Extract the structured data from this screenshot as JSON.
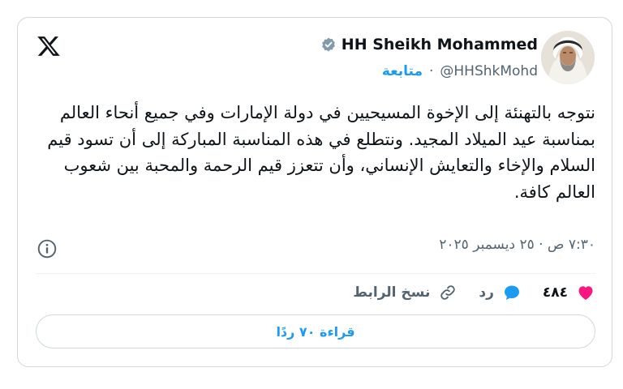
{
  "author": {
    "display_name": "HH Sheikh Mohammed",
    "handle": "@HHShkMohd",
    "separator": "·",
    "follow_label": "متابعة",
    "verified_color": "#829aab"
  },
  "tweet": {
    "text": "نتوجه بالتهنئة إلى الإخوة المسيحيين في دولة الإمارات وفي جميع أنحاء العالم بمناسبة عيد الميلاد المجيد. ونتطلع في هذه المناسبة المباركة إلى أن تسود قيم السلام والإخاء والتعايش الإنساني، وأن تتعزز قيم الرحمة والمحبة بين شعوب العالم كافة.",
    "timestamp": "٧:٣٠ ص · ٢٥ ديسمبر ٢٠٢٥"
  },
  "actions": {
    "like_count": "٤٨٤",
    "reply_label": "رد",
    "copy_link_label": "نسخ الرابط"
  },
  "read_replies_label": "قراءة ٧٠ ردًا",
  "colors": {
    "accent": "#1d9bf0",
    "like": "#f91880",
    "muted": "#536471",
    "border": "#cfd9de"
  },
  "icons": [
    "x-logo-icon",
    "verified-badge-icon",
    "info-icon",
    "heart-icon",
    "reply-bubble-icon",
    "link-icon",
    "profile-avatar"
  ]
}
